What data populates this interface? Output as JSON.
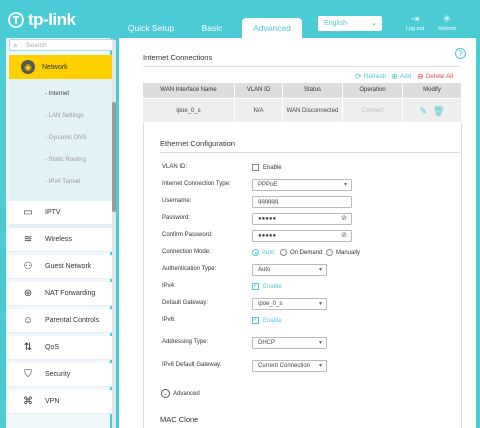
{
  "header": {
    "brand": "tp-link",
    "tabs": [
      "Quick Setup",
      "Basic",
      "Advanced"
    ],
    "language": "English",
    "logout_label": "Log out",
    "reboot_label": "Reboot"
  },
  "sidebar": {
    "search_placeholder": "Search",
    "active_item": "Network",
    "subitems": [
      "- Internet",
      "- LAN Settings",
      "- Dynamic DNS",
      "- Static Routing",
      "- IPv6 Tunnel"
    ],
    "items": [
      "IPTV",
      "Wireless",
      "Guest Network",
      "NAT Forwarding",
      "Parental Controls",
      "QoS",
      "Security",
      "VPN"
    ]
  },
  "main": {
    "section_title": "Internet Connections",
    "toolbar": {
      "refresh": "Refresh",
      "add": "Add",
      "delete_all": "Delete All"
    },
    "table": {
      "headers": [
        "WAN Interface Name",
        "VLAN ID",
        "Status",
        "Operation",
        "Modify"
      ],
      "row": {
        "name": "ipoe_0_s",
        "vlan": "N/A",
        "status": "WAN Disconnected",
        "operation": "Connect"
      }
    },
    "ethernet": {
      "title": "Ethernet Configuration",
      "vlan_id_label": "VLAN ID:",
      "vlan_enable": "Enable",
      "conn_type_label": "Internet Connection Type:",
      "conn_type_value": "PPPoE",
      "username_label": "Username:",
      "username_value": "qqqqqq",
      "password_label": "Password:",
      "password_value": "●●●●●",
      "confirm_password_label": "Confirm Password:",
      "confirm_password_value": "●●●●●",
      "conn_mode_label": "Connection Mode:",
      "conn_modes": [
        "Auto",
        "On Demand",
        "Manually"
      ],
      "auth_type_label": "Authentication Type:",
      "auth_type_value": "Auto",
      "ipv4_label": "IPv4:",
      "ipv4_enable": "Enable",
      "gateway_label": "Default Gateway:",
      "gateway_value": "ipoe_0_s",
      "ipv6_label": "IPv6:",
      "ipv6_enable": "Enable",
      "addressing_type_label": "Addressing Type:",
      "addressing_type_value": "DHCP",
      "ipv6_gateway_label": "IPv6 Default Gateway:",
      "ipv6_gateway_value": "Current Connection",
      "advanced_label": "Advanced"
    },
    "mac_clone_title": "MAC Clone"
  },
  "colors": {
    "accent": "#4acbd6",
    "active_nav": "#ffd000",
    "danger": "#d9534f"
  }
}
